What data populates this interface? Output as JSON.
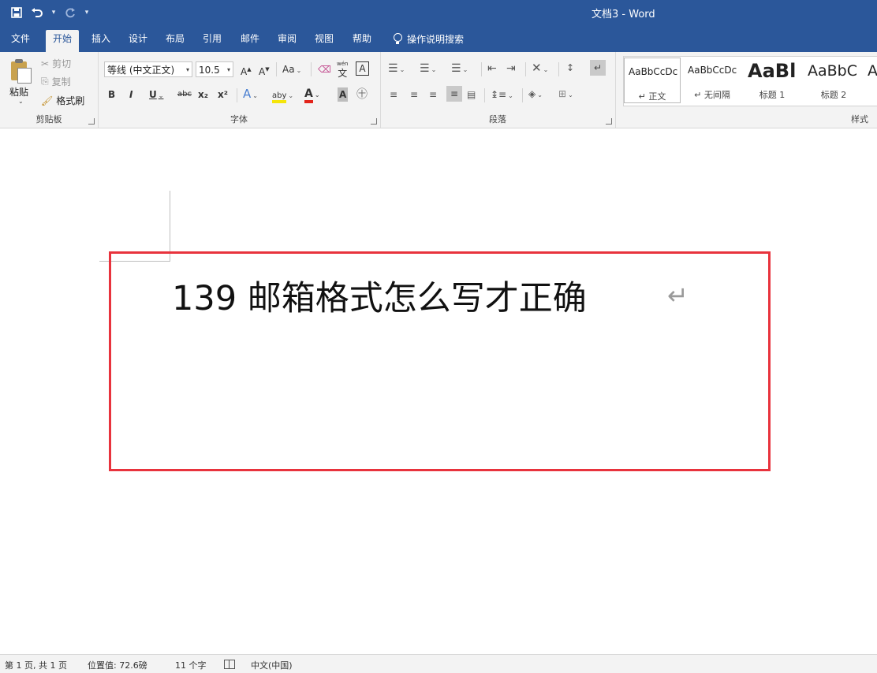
{
  "titlebar": {
    "title": "文档3  -  Word",
    "qat": {
      "save_icon": "save-icon",
      "undo_icon": "undo-icon",
      "redo_icon": "redo-icon"
    }
  },
  "tabs": [
    {
      "label": "文件"
    },
    {
      "label": "开始"
    },
    {
      "label": "插入"
    },
    {
      "label": "设计"
    },
    {
      "label": "布局"
    },
    {
      "label": "引用"
    },
    {
      "label": "邮件"
    },
    {
      "label": "审阅"
    },
    {
      "label": "视图"
    },
    {
      "label": "帮助"
    }
  ],
  "active_tab": "开始",
  "tell_me": "操作说明搜索",
  "clipboard": {
    "paste": "粘贴",
    "cut": "剪切",
    "copy": "复制",
    "format_painter": "格式刷",
    "label": "剪贴板"
  },
  "font": {
    "font_name": "等线 (中文正文)",
    "font_size": "10.5",
    "case": "Aa",
    "phonetic_label": "wén",
    "phonetic_char": "文",
    "border_char": "A",
    "bold": "B",
    "italic": "I",
    "underline": "U",
    "strike": "abc",
    "subscript": "x₂",
    "superscript": "x²",
    "effects": "A",
    "highlight": "aby",
    "font_color": "A",
    "shading": "A",
    "grow": "A",
    "shrink": "A",
    "label": "字体"
  },
  "paragraph": {
    "label": "段落"
  },
  "styles": {
    "items": [
      {
        "sample": "AaBbCcDc",
        "name": "↵ 正文"
      },
      {
        "sample": "AaBbCcDc",
        "name": "↵ 无间隔"
      },
      {
        "sample": "AaBl",
        "name": "标题 1"
      },
      {
        "sample": "AaBbC",
        "name": "标题 2"
      },
      {
        "sample": "A",
        "name": ""
      }
    ],
    "label": "样式"
  },
  "document": {
    "heading": "139 邮箱格式怎么写才正确",
    "para_mark": "↵"
  },
  "status": {
    "page": "第 1 页, 共 1 页",
    "position": "位置值: 72.6磅",
    "words": "11 个字",
    "language": "中文(中国)"
  },
  "colors": {
    "accent": "#2b579a",
    "highlight_box": "#e8333d",
    "ribbon_bg": "#f3f3f3"
  }
}
